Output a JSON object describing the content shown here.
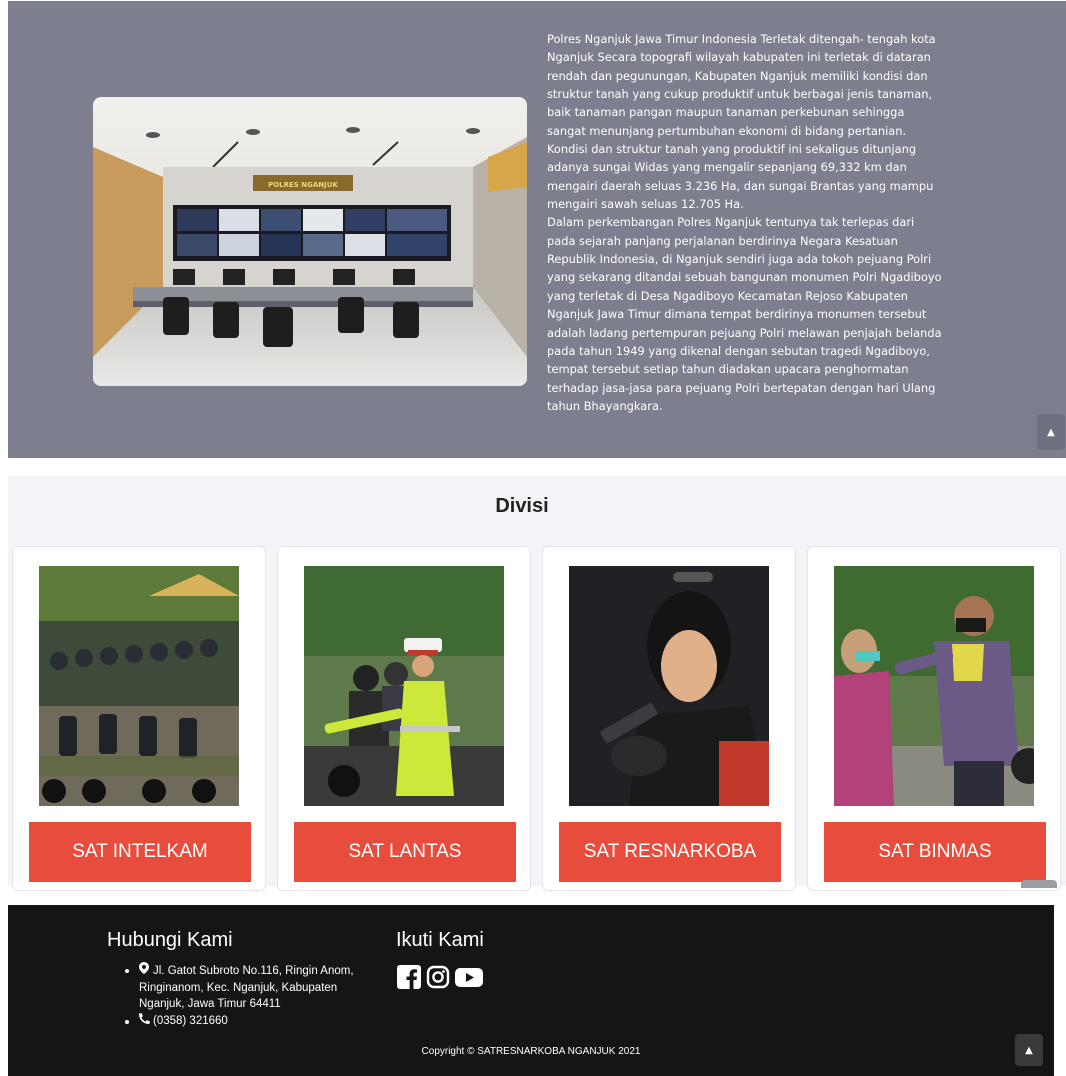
{
  "about": {
    "paragraphs": [
      "Polres Nganjuk Jawa Timur Indonesia Terletak ditengah- tengah kota Nganjuk Secara topografi wilayah kabupaten ini terletak di dataran rendah dan pegunungan, Kabupaten Nganjuk memiliki kondisi dan struktur tanah yang cukup produktif untuk berbagai jenis tanaman, baik tanaman pangan maupun tanaman perkebunan sehingga sangat menunjang pertumbuhan ekonomi di bidang pertanian. Kondisi dan struktur tanah yang produktif ini sekaligus ditunjang adanya sungai Widas yang mengalir sepanjang 69,332 km dan mengairi daerah seluas 3.236 Ha, dan sungai Brantas yang mampu mengairi sawah seluas 12.705 Ha.",
      "Dalam perkembangan Polres Nganjuk tentunya tak terlepas dari pada sejarah panjang perjalanan berdirinya Negara Kesatuan Republik Indonesia, di Nganjuk sendiri juga ada tokoh pejuang Polri yang sekarang ditandai sebuah bangunan monumen Polri Ngadiboyo yang terletak di Desa Ngadiboyo Kecamatan Rejoso Kabupaten Nganjuk Jawa Timur dimana tempat berdirinya monumen tersebut adalah ladang pertempuran pejuang Polri melawan penjajah belanda pada tahun 1949 yang dikenal dengan sebutan tragedi Ngadiboyo, tempat tersebut setiap tahun diadakan upacara penghormatan terhadap jasa-jasa para pejuang Polri bertepatan dengan hari Ulang tahun Bhayangkara."
    ],
    "photo_sign": "POLRES NGANJUK"
  },
  "divisi": {
    "title": "Divisi",
    "cards": [
      {
        "label": "SAT INTELKAM"
      },
      {
        "label": "SAT LANTAS"
      },
      {
        "label": "SAT RESNARKOBA"
      },
      {
        "label": "SAT BINMAS"
      }
    ]
  },
  "footer": {
    "contact_title": "Hubungi Kami",
    "address": "Jl. Gatot Subroto No.116, Ringin Anom, Ringinanom, Kec. Nganjuk, Kabupaten Nganjuk, Jawa Timur 64411",
    "phone": "(0358) 321660",
    "follow_title": "Ikuti Kami",
    "social_icons": [
      "facebook-icon",
      "instagram-icon",
      "youtube-icon"
    ],
    "copyright": "Copyright © SATRESNARKOBA NGANJUK 2021"
  },
  "colors": {
    "about_bg": "#7d7f8e",
    "divisi_bg": "#f3f4f8",
    "button_red": "#e74c3c",
    "footer_bg": "#151515"
  }
}
